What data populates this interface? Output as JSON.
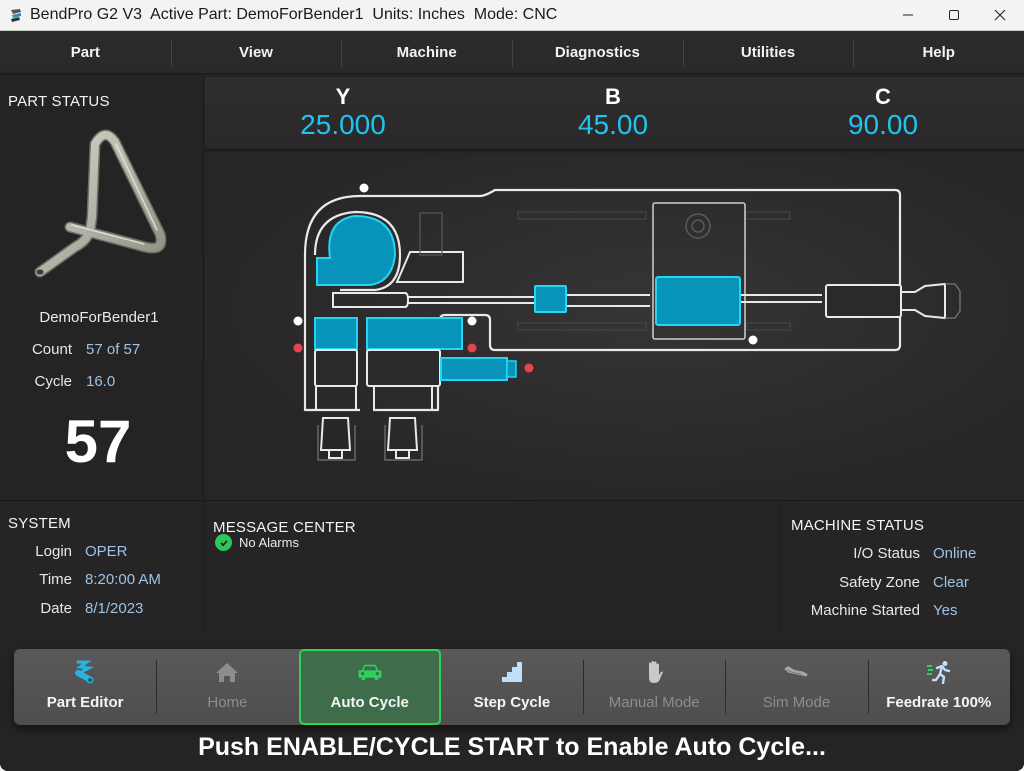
{
  "window": {
    "title": "BendPro G2 V3  Active Part: DemoForBender1  Units: Inches  Mode: CNC",
    "controls": {
      "minimize": "—",
      "maximize": "☐",
      "close": "✕"
    }
  },
  "menu": {
    "items": [
      {
        "label": "Part"
      },
      {
        "label": "View"
      },
      {
        "label": "Machine"
      },
      {
        "label": "Diagnostics"
      },
      {
        "label": "Utilities"
      },
      {
        "label": "Help"
      }
    ]
  },
  "part_status": {
    "title": "PART STATUS",
    "part_name": "DemoForBender1",
    "count_label": "Count",
    "count_value": "57 of 57",
    "cycle_label": "Cycle",
    "cycle_value": "16.0",
    "big_count": "57"
  },
  "axes": [
    {
      "label": "Y",
      "value": "25.000"
    },
    {
      "label": "B",
      "value": "45.00"
    },
    {
      "label": "C",
      "value": "90.00"
    }
  ],
  "system": {
    "title": "SYSTEM",
    "rows": [
      {
        "label": "Login",
        "value": "OPER"
      },
      {
        "label": "Time",
        "value": "8:20:00 AM"
      },
      {
        "label": "Date",
        "value": "8/1/2023"
      }
    ]
  },
  "message_center": {
    "title": "MESSAGE CENTER",
    "messages": [
      {
        "icon": "check-circle-icon",
        "text": "No Alarms"
      }
    ]
  },
  "machine_status": {
    "title": "MACHINE STATUS",
    "rows": [
      {
        "label": "I/O Status",
        "value": "Online"
      },
      {
        "label": "Safety Zone",
        "value": "Clear"
      },
      {
        "label": "Machine Started",
        "value": "Yes"
      }
    ]
  },
  "toolbar": {
    "items": [
      {
        "label": "Part Editor",
        "icon": "tube-icon",
        "state": "enabled"
      },
      {
        "label": "Home",
        "icon": "home-icon",
        "state": "disabled"
      },
      {
        "label": "Auto Cycle",
        "icon": "car-icon",
        "state": "active"
      },
      {
        "label": "Step Cycle",
        "icon": "stairs-icon",
        "state": "enabled"
      },
      {
        "label": "Manual Mode",
        "icon": "hand-icon",
        "state": "disabled"
      },
      {
        "label": "Sim Mode",
        "icon": "machine-icon",
        "state": "disabled"
      },
      {
        "label": "Feedrate 100%",
        "icon": "running-icon",
        "state": "enabled"
      }
    ]
  },
  "prompt": "Push ENABLE/CYCLE START to Enable Auto Cycle...",
  "colors": {
    "accent_cyan": "#1fc4ef",
    "value_blue": "#9ec3e6",
    "active_green": "#30d15a",
    "alarm_red": "#e8444c"
  }
}
